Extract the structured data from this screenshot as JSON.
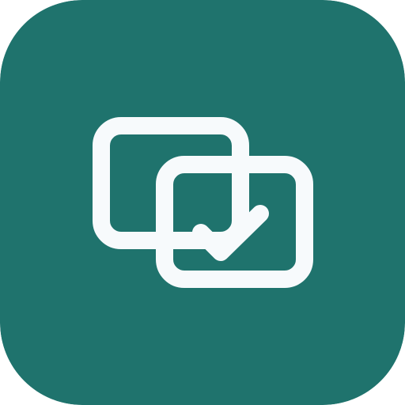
{
  "app_icon": {
    "icon": "overlapping-windows-check-icon",
    "colors": {
      "tile_background": "#1F736D",
      "glyph": "#F7FAFC"
    }
  }
}
